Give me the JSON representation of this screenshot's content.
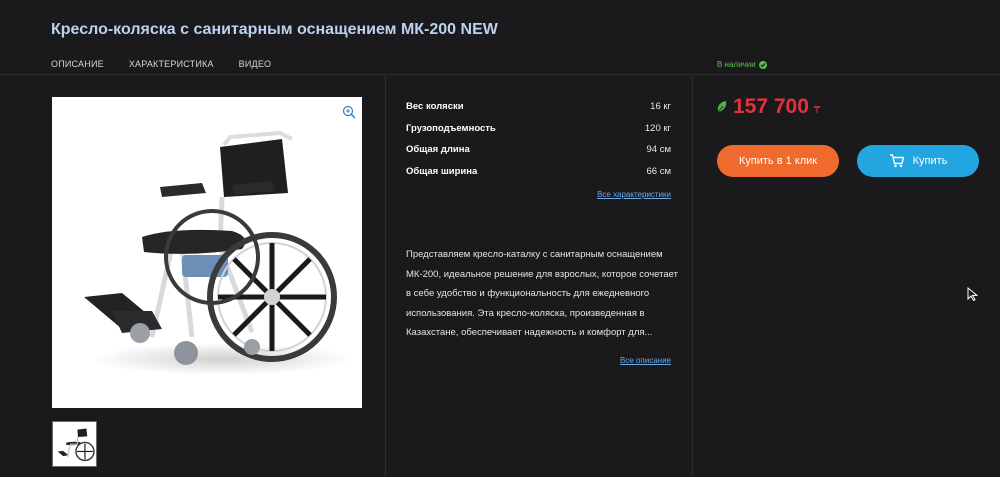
{
  "product": {
    "title": "Кресло-коляска с санитарным оснащением МК-200 NEW"
  },
  "tabs": [
    {
      "label": "ОПИСАНИЕ"
    },
    {
      "label": "ХАРАКТЕРИСТИКА"
    },
    {
      "label": "ВИДЕО"
    }
  ],
  "stock": {
    "label": "В наличии"
  },
  "specs": [
    {
      "name": "Вес коляски",
      "value": "16 кг"
    },
    {
      "name": "Грузоподъемность",
      "value": "120 кг"
    },
    {
      "name": "Общая длина",
      "value": "94 см"
    },
    {
      "name": "Общая ширина",
      "value": "66 см"
    }
  ],
  "links": {
    "all_specs": "Все характеристики",
    "all_description": "Все описание"
  },
  "description": "Представляем кресло-каталку с санитарным оснащением МК-200, идеальное решение для взрослых, которое сочетает в себе удобство и функциональность для ежедневного использования. Эта кресло-коляска, произведенная в Казахстане, обеспечивает надежность и комфорт для...",
  "price": {
    "value": "157 700",
    "currency": "₸"
  },
  "buttons": {
    "one_click": "Купить в 1 клик",
    "buy": "Купить"
  },
  "colors": {
    "title": "#b9d2f0",
    "price": "#e3323c",
    "stock": "#55c348",
    "one_click_button": "#ef6a2c",
    "buy_button": "#23a6e0",
    "link": "#6aa9e8"
  },
  "icons": {
    "zoom": "zoom-in-icon",
    "cart": "cart-icon",
    "stock": "check-circle-icon",
    "price_tag": "leaf-tag-icon",
    "cursor": "mouse-pointer-icon"
  }
}
